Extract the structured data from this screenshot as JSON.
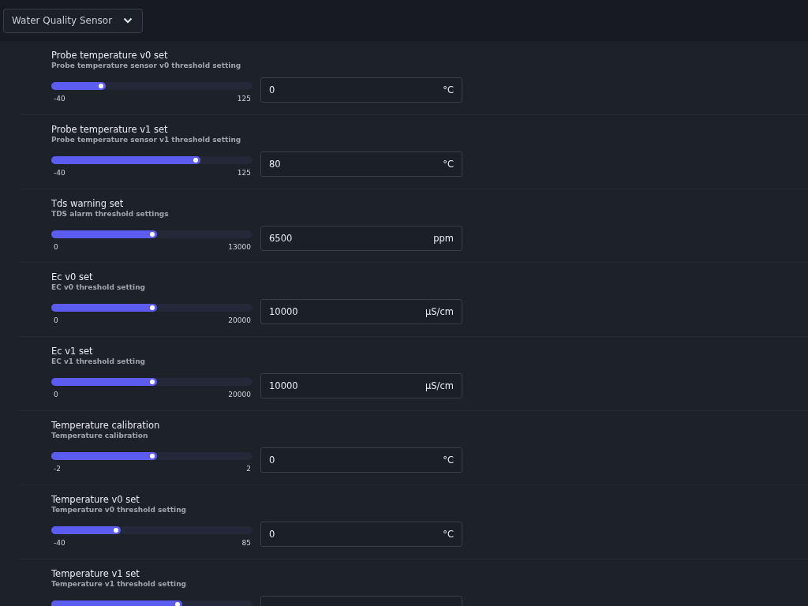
{
  "device_select": {
    "value": "Water Quality Sensor"
  },
  "settings": [
    {
      "title": "Probe temperature v0 set",
      "description": "Probe temperature sensor v0 threshold setting",
      "level": 0.27,
      "min": "-40",
      "max": "125",
      "value": "0",
      "unit": "°C"
    },
    {
      "title": "Probe temperature v1 set",
      "description": "Probe temperature sensor v1 threshold setting",
      "level": 0.74,
      "min": "-40",
      "max": "125",
      "value": "80",
      "unit": "°C"
    },
    {
      "title": "Tds warning set",
      "description": "TDS alarm threshold settings",
      "level": 0.525,
      "min": "0",
      "max": "13000",
      "value": "6500",
      "unit": "ppm"
    },
    {
      "title": "Ec v0 set",
      "description": "EC v0 threshold setting",
      "level": 0.525,
      "min": "0",
      "max": "20000",
      "value": "10000",
      "unit": "µS/cm"
    },
    {
      "title": "Ec v1 set",
      "description": "EC v1 threshold setting",
      "level": 0.525,
      "min": "0",
      "max": "20000",
      "value": "10000",
      "unit": "µS/cm"
    },
    {
      "title": "Temperature calibration",
      "description": "Temperature calibration",
      "level": 0.525,
      "min": "-2",
      "max": "2",
      "value": "0",
      "unit": "°C"
    },
    {
      "title": "Temperature v0 set",
      "description": "Temperature v0 threshold setting",
      "level": 0.345,
      "min": "-40",
      "max": "85",
      "value": "0",
      "unit": "°C"
    },
    {
      "title": "Temperature v1 set",
      "description": "Temperature v1 threshold setting",
      "level": 0.65
    }
  ]
}
